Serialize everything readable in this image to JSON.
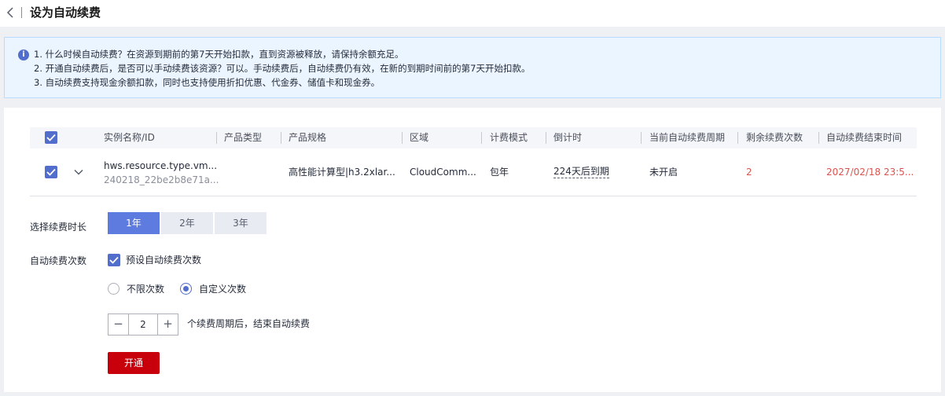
{
  "header": {
    "title": "设为自动续费"
  },
  "notice": {
    "lines": [
      "1. 什么时候自动续费？在资源到期前的第7天开始扣款，直到资源被释放，请保持余额充足。",
      "2. 开通自动续费后，是否可以手动续费该资源？可以。手动续费后，自动续费仍有效，在新的到期时间前的第7天开始扣款。",
      "3. 自动续费支持现金余额扣款，同时也支持使用折扣优惠、代金券、储值卡和现金券。"
    ]
  },
  "table": {
    "columns": [
      "实例名称/ID",
      "产品类型",
      "产品规格",
      "区域",
      "计费模式",
      "倒计时",
      "当前自动续费周期",
      "剩余续费次数",
      "自动续费结束时间"
    ],
    "row": {
      "name": "hws.resource.type.vm...",
      "id": "240218_22be2b8e71a...",
      "type": "",
      "spec": "高性能计算型|h3.2xlar...",
      "region": "CloudComm...",
      "billing": "包年",
      "countdown": "224天后到期",
      "cycle": "未开启",
      "remaining": "2",
      "end_time": "2027/02/18 23:5..."
    }
  },
  "form": {
    "duration_label": "选择续费时长",
    "durations": [
      "1年",
      "2年",
      "3年"
    ],
    "count_label": "自动续费次数",
    "preset_label": "预设自动续费次数",
    "radio_unlimited": "不限次数",
    "radio_custom": "自定义次数",
    "stepper_value": "2",
    "stepper_suffix": "个续费周期后，结束自动续费",
    "submit_label": "开通"
  },
  "colors": {
    "primary": "#526ecc",
    "accent_red": "#c7000b",
    "warn_text": "#d9534f"
  }
}
